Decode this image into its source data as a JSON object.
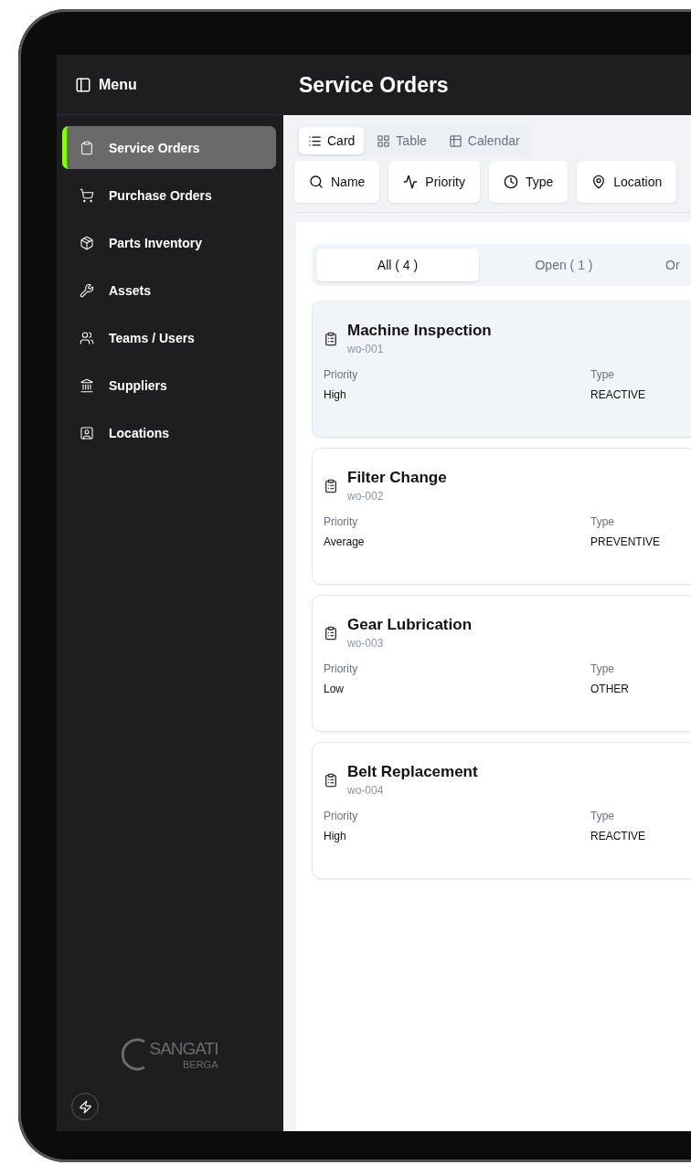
{
  "sidebar": {
    "title": "Menu",
    "items": [
      {
        "label": "Service Orders",
        "selected": true,
        "kind": "clipboard"
      },
      {
        "label": "Purchase Orders",
        "selected": false,
        "kind": "cart"
      },
      {
        "label": "Parts Inventory",
        "selected": false,
        "kind": "package"
      },
      {
        "label": "Assets",
        "selected": false,
        "kind": "wrench"
      },
      {
        "label": "Teams / Users",
        "selected": false,
        "kind": "users"
      },
      {
        "label": "Suppliers",
        "selected": false,
        "kind": "bank"
      },
      {
        "label": "Locations",
        "selected": false,
        "kind": "location"
      }
    ],
    "logo": {
      "name": "SANGATI",
      "sub": "BERGA"
    }
  },
  "header": {
    "title": "Service Orders"
  },
  "views": [
    {
      "label": "Card",
      "selected": true,
      "kind": "list"
    },
    {
      "label": "Table",
      "selected": false,
      "kind": "grid"
    },
    {
      "label": "Calendar",
      "selected": false,
      "kind": "calendar"
    }
  ],
  "filters": [
    {
      "label": "Name",
      "kind": "search"
    },
    {
      "label": "Priority",
      "kind": "activity"
    },
    {
      "label": "Type",
      "kind": "clock"
    },
    {
      "label": "Location",
      "kind": "pin"
    }
  ],
  "status_tabs": [
    {
      "label": "All ( 4 )",
      "selected": true
    },
    {
      "label": "Open ( 1 )",
      "selected": false
    },
    {
      "label": "Or",
      "selected": false
    }
  ],
  "orders": [
    {
      "title": "Machine Inspection",
      "code": "wo-001",
      "priority_label": "Priority",
      "priority": "High",
      "type_label": "Type",
      "type": "REACTIVE",
      "selected": true
    },
    {
      "title": "Filter Change",
      "code": "wo-002",
      "priority_label": "Priority",
      "priority": "Average",
      "type_label": "Type",
      "type": "PREVENTIVE",
      "selected": false
    },
    {
      "title": "Gear Lubrication",
      "code": "wo-003",
      "priority_label": "Priority",
      "priority": "Low",
      "type_label": "Type",
      "type": "OTHER",
      "selected": false
    },
    {
      "title": "Belt Replacement",
      "code": "wo-004",
      "priority_label": "Priority",
      "priority": "High",
      "type_label": "Type",
      "type": "REACTIVE",
      "selected": false
    }
  ]
}
